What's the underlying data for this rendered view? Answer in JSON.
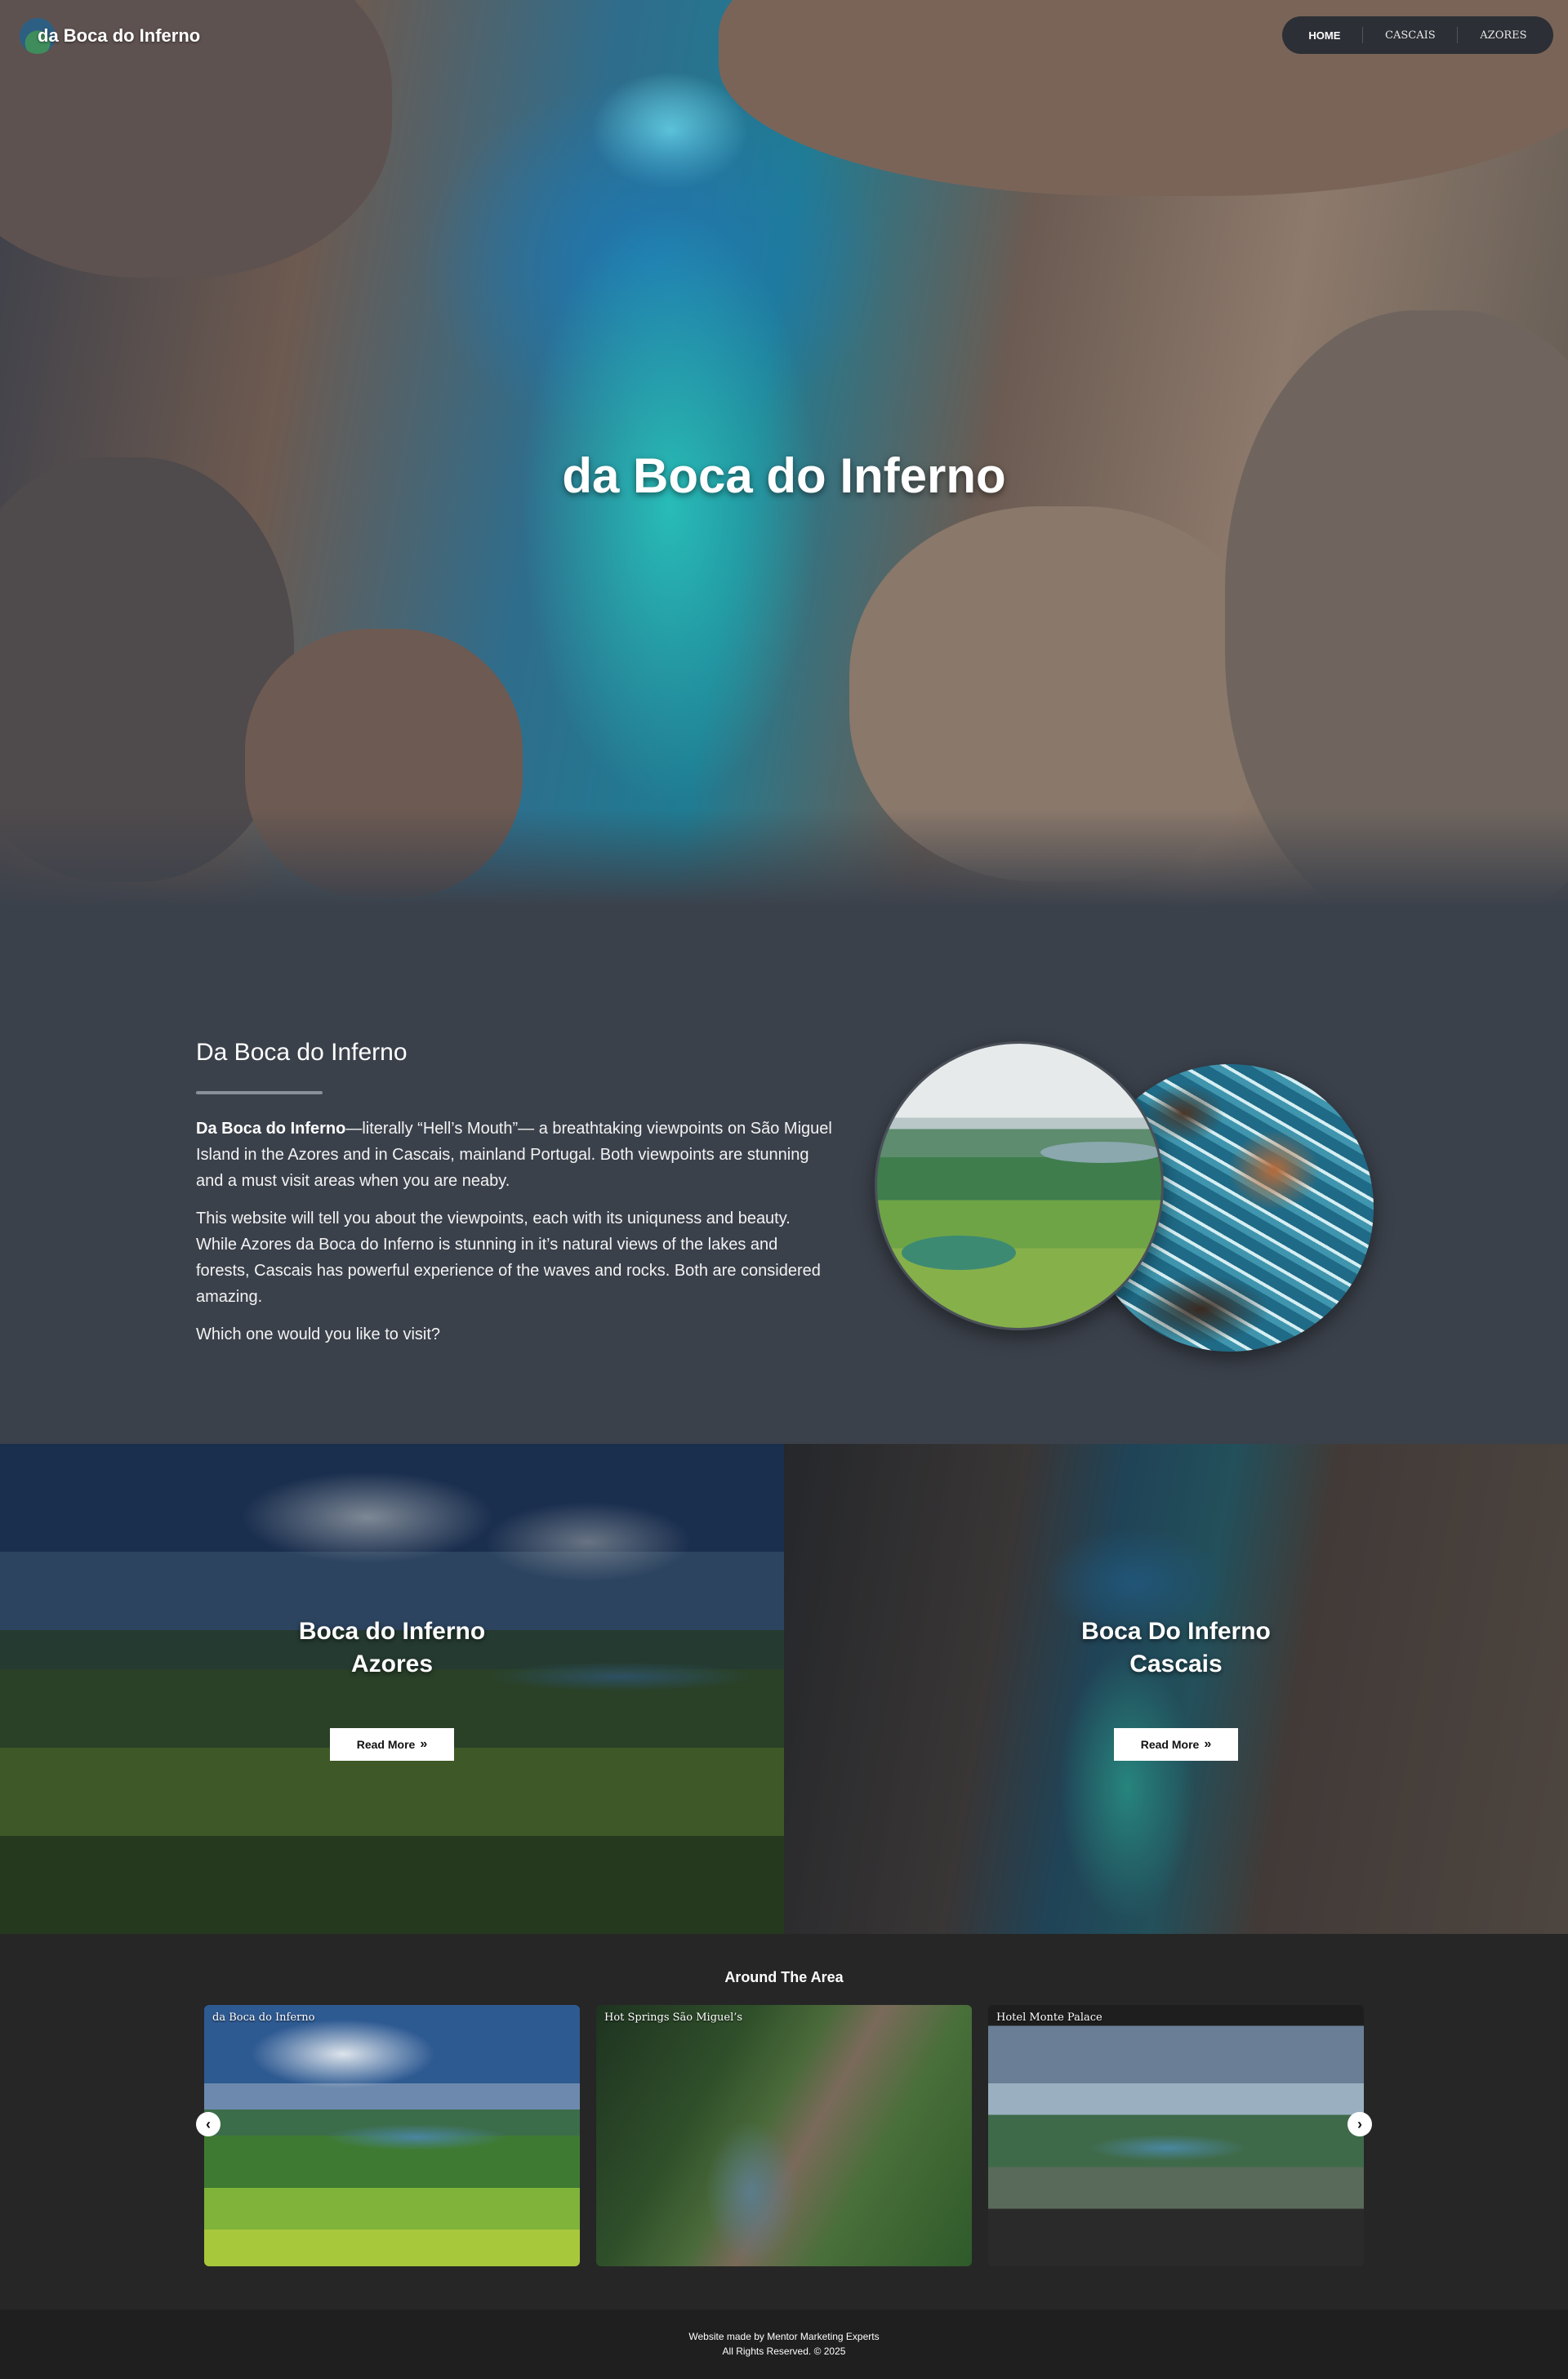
{
  "header": {
    "logo_text": "da Boca do Inferno",
    "nav": [
      {
        "label": "HOME",
        "active": true
      },
      {
        "label": "CASCAIS",
        "active": false
      },
      {
        "label": "AZORES",
        "active": false
      }
    ]
  },
  "hero": {
    "title": "da Boca do Inferno"
  },
  "intro": {
    "heading": "Da Boca do Inferno",
    "p1_bold": "Da Boca do Inferno",
    "p1_rest": "—literally “Hell’s Mouth”— a breathtaking viewpoints on São Miguel Island in the Azores and in Cascais, mainland Portugal. Both viewpoints are stunning and a must visit areas when you are neaby.",
    "p2": "This website will tell you about the viewpoints, each with its uniquness and beauty. While Azores da Boca do Inferno is stunning in it’s natural views of the lakes and forests, Cascais has powerful experience of the waves and rocks. Both are considered amazing.",
    "p3": "Which one would you like to visit?"
  },
  "destinations": [
    {
      "title_line1": "Boca do Inferno",
      "title_line2": "Azores",
      "button": "Read More",
      "button_icon": "double-chevron-right-icon"
    },
    {
      "title_line1": "Boca Do Inferno",
      "title_line2": "Cascais",
      "button": "Read More",
      "button_icon": "double-chevron-right-icon"
    }
  ],
  "around": {
    "title": "Around The Area",
    "slides": [
      {
        "label": "da Boca do Inferno"
      },
      {
        "label": "Hot Springs São Miguel’s"
      },
      {
        "label": "Hotel Monte Palace"
      }
    ],
    "prev_icon": "chevron-left-icon",
    "next_icon": "chevron-right-icon"
  },
  "footer": {
    "line1": "Website made by Mentor Marketing Experts",
    "line2": "All Rights Reserved. © 2025"
  },
  "colors": {
    "intro_bg": "#3b414b",
    "page_bg": "#262626",
    "footer_bg": "#1f1f1f",
    "nav_bg": "#2c2f35"
  }
}
